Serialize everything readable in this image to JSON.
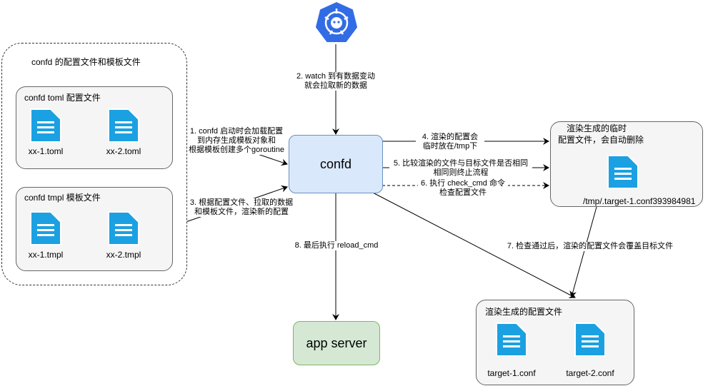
{
  "colors": {
    "k8s_blue": "#326ce5",
    "file_cyan": "#1ba1e2",
    "confd_fill": "#dae8fc",
    "confd_stroke": "#6c8ebf",
    "app_fill": "#d5e8d4",
    "app_stroke": "#82b366",
    "panel_fill": "#f5f5f5"
  },
  "icons": {
    "top_service": "kubernetes-helm-icon",
    "file": "document-icon"
  },
  "groups": {
    "confd_files_title": "confd 的配置文件和模板文件",
    "toml_title": "confd toml 配置文件",
    "toml_files": [
      "xx-1.toml",
      "xx-2.toml"
    ],
    "tmpl_title": "confd tmpl 模板文件",
    "tmpl_files": [
      "xx-1.tmpl",
      "xx-2.tmpl"
    ],
    "temp_title_line1": "渲染生成的临时",
    "temp_title_line2": "配置文件，会自动删除",
    "temp_file": "/tmp/.target-1.conf393984981",
    "target_title": "渲染生成的配置文件",
    "target_files": [
      "target-1.conf",
      "target-2.conf"
    ]
  },
  "nodes": {
    "confd": "confd",
    "app_server": "app server"
  },
  "edges": {
    "e1": [
      "1. confd 启动时会加载配置",
      "到内存生成模板对象和",
      "根据模板创建多个goroutine"
    ],
    "e2": [
      "2. watch 到有数据变动",
      "就会拉取新的数据"
    ],
    "e3": [
      "3. 根据配置文件、拉取的数据",
      "和模板文件，渲染新的配置"
    ],
    "e4": [
      "4. 渲染的配置会",
      "临时放在/tmp下"
    ],
    "e5": [
      "5. 比较渲染的文件与目标文件是否相同",
      "相同则终止流程"
    ],
    "e6": [
      "6. 执行 check_cmd 命令",
      "检查配置文件"
    ],
    "e7": [
      "7. 检查通过后，渲染的配置文件会覆盖目标文件"
    ],
    "e8": [
      "8. 最后执行 reload_cmd"
    ]
  }
}
